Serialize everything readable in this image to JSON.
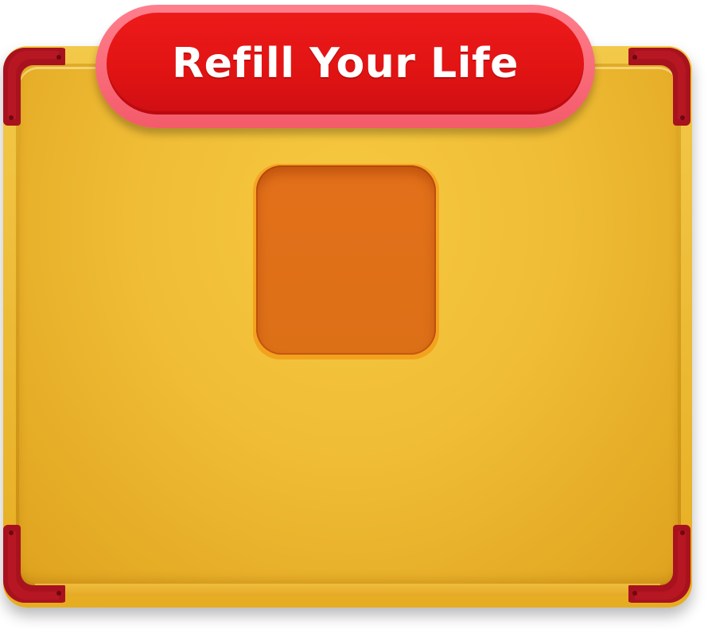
{
  "banner": {
    "title": "Refill Your Life"
  },
  "slot": {
    "content": ""
  },
  "colors": {
    "panel": "#f0bd36",
    "rim": "#e6ad22",
    "corner": "#a8121e",
    "banner": "#e01313",
    "banner_border": "#f45a6a",
    "slot": "#dc7017"
  }
}
